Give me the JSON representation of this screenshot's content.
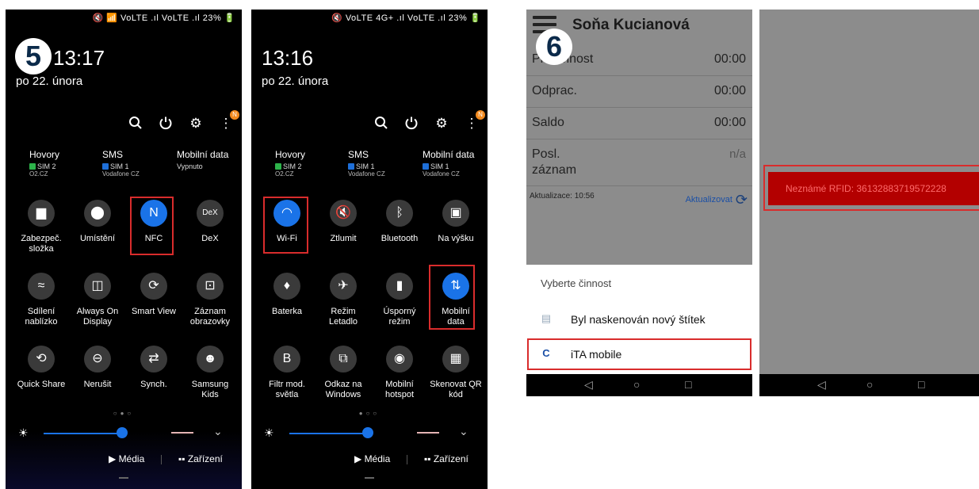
{
  "panel1": {
    "status": "🔇 📶 VoLTE .ıl VoLTE .ıl 23% 🔋",
    "step": "5",
    "time": "13:17",
    "date": "po 22. února",
    "tool_icons": [
      "search-icon",
      "power-icon",
      "gear-icon",
      "more-icon"
    ],
    "notif_badge": "N",
    "sim": [
      {
        "title": "Hovory",
        "sim": "SIM 2",
        "sim_color": "#2db34a",
        "carrier": "O2.CZ"
      },
      {
        "title": "SMS",
        "sim": "SIM 1",
        "sim_color": "#1e6fd9",
        "carrier": "Vodafone CZ"
      },
      {
        "title": "Mobilní data",
        "status": "Vypnuto"
      }
    ],
    "tiles": [
      "Zabezpeč.\nsložka",
      "Umístění",
      "NFC",
      "DeX",
      "Sdílení\nnablízko",
      "Always On\nDisplay",
      "Smart View",
      "Záznam\nobrazovky",
      "Quick Share",
      "Nerušit",
      "Synch.",
      "Samsung\nKids"
    ],
    "media": "Média",
    "devices": "Zařízení"
  },
  "panel2": {
    "status": "🔇 VoLTE 4G+ .ıl VoLTE .ıl 23% 🔋",
    "time": "13:16",
    "date": "po 22. února",
    "notif_badge": "N",
    "sim": [
      {
        "title": "Hovory",
        "sim": "SIM 2",
        "sim_color": "#2db34a",
        "carrier": "O2.CZ"
      },
      {
        "title": "SMS",
        "sim": "SIM 1",
        "sim_color": "#1e6fd9",
        "carrier": "Vodafone CZ"
      },
      {
        "title": "Mobilní data",
        "sim": "SIM 1",
        "sim_color": "#1e6fd9",
        "carrier": "Vodafone CZ"
      }
    ],
    "tiles": [
      "Wi-Fi",
      "Ztlumit",
      "Bluetooth",
      "Na výšku",
      "Baterka",
      "Režim\nLetadlo",
      "Úsporný\nrežim",
      "Mobilní\ndata",
      "Filtr mod.\nsvětla",
      "Odkaz na\nWindows",
      "Mobilní\nhotspot",
      "Skenovat QR\nkód"
    ],
    "media": "Média",
    "devices": "Zařízení"
  },
  "panel3": {
    "step": "6",
    "app_title": "Soňa Kucianová",
    "rows": [
      {
        "k": "Přítomnost",
        "v": "00:00"
      },
      {
        "k": "Odprac.",
        "v": "00:00"
      },
      {
        "k": "Saldo",
        "v": "00:00"
      },
      {
        "k": "Posl.\nzáznam",
        "v": "n/a"
      }
    ],
    "update_time": "Aktualizace: 10:56",
    "update_btn": "Aktualizovat",
    "chooser_title": "Vyberte činnost",
    "option1": "Byl naskenován nový štítek",
    "option2": "iTA mobile"
  },
  "panel4": {
    "rfid_message": "Neznámé RFID: 36132883719572228"
  },
  "colors": {
    "accent_blue": "#1a73e8",
    "highlight_red": "#d92c2c",
    "error_red": "#b30000"
  }
}
